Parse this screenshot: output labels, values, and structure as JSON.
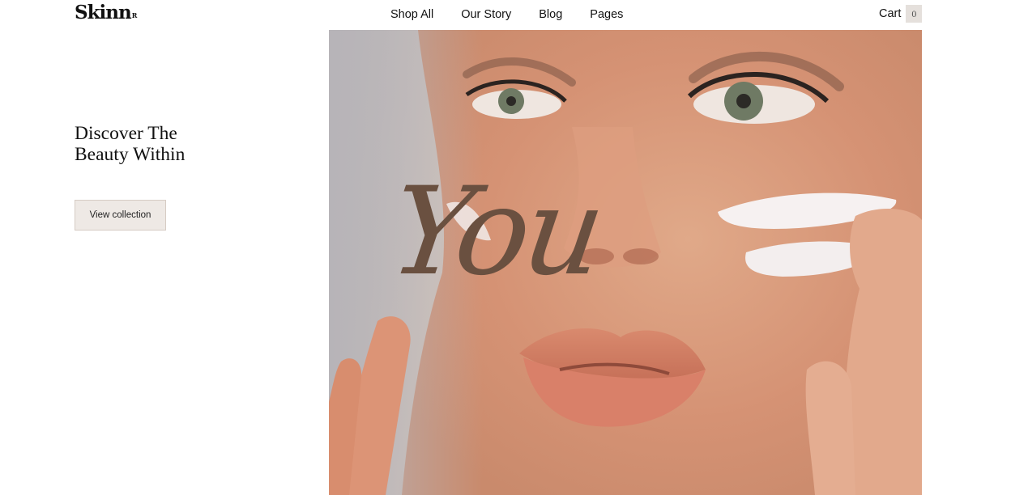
{
  "brand": {
    "logo_text": "Skinn",
    "logo_mark": "R"
  },
  "nav": {
    "items": [
      {
        "label": "Shop All"
      },
      {
        "label": "Our Story"
      },
      {
        "label": "Blog"
      },
      {
        "label": "Pages"
      }
    ]
  },
  "cart": {
    "label": "Cart",
    "count": "0"
  },
  "hero": {
    "title_line1": "Discover The",
    "title_line2": "Beauty Within",
    "cta_label": "View collection",
    "script_word": "You"
  },
  "colors": {
    "cta_background": "#eee9e5",
    "cart_badge_background": "#e5e0dc",
    "script_text": "#6a5040"
  }
}
